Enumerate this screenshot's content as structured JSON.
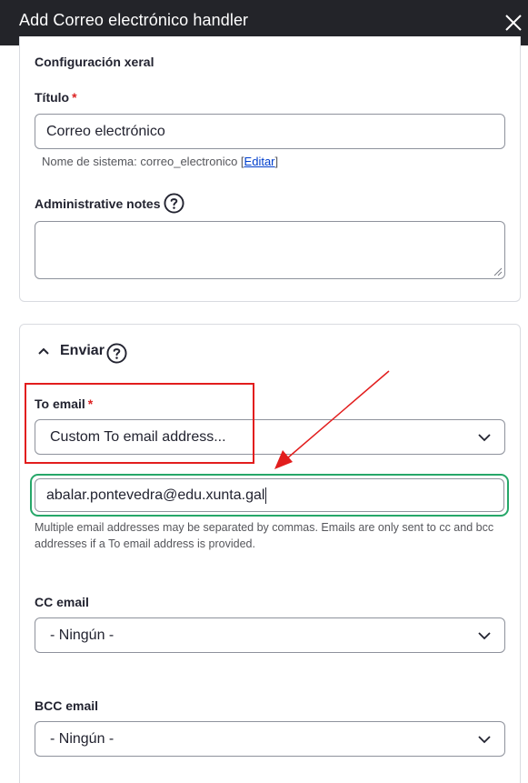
{
  "dialog": {
    "title": "Add Correo electrónico handler",
    "close_icon": "close-icon"
  },
  "general": {
    "section_title": "Configuración xeral",
    "title_label": "Título",
    "required_mark": "*",
    "title_value": "Correo electrónico",
    "machine_name_prefix": "Nome de sistema: correo_electronico [",
    "machine_name_link": "Editar",
    "machine_name_suffix": "]",
    "admin_notes_label": "Administrative notes"
  },
  "send": {
    "section_title": "Enviar",
    "to_label": "To email",
    "to_selected": "Custom To email address...",
    "to_custom_value": "abalar.pontevedra@edu.xunta.gal",
    "to_description": "Multiple email addresses may be separated by commas. Emails are only sent to cc and bcc addresses if a To email address is provided.",
    "cc_label": "CC email",
    "cc_selected": "- Ningún -",
    "bcc_label": "BCC email",
    "bcc_selected": "- Ningún -"
  },
  "colors": {
    "header_bg": "#232429",
    "required": "#dc2323",
    "highlight_box": "#e21d1d",
    "focus_ring": "#26a769",
    "link": "#003ecc"
  }
}
